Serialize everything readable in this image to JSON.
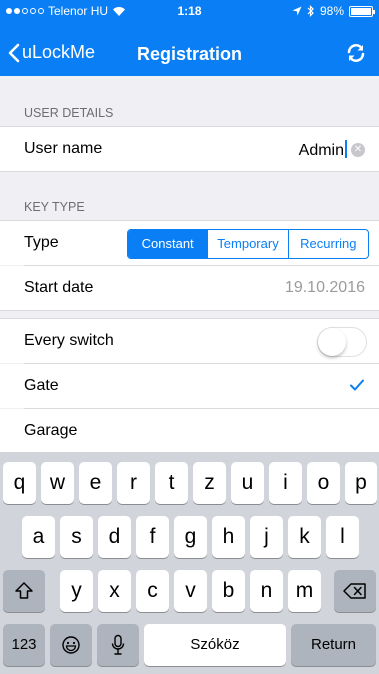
{
  "status_bar": {
    "carrier": "Telenor HU",
    "time": "1:18",
    "battery": "98%"
  },
  "nav": {
    "back_label": "uLockMe",
    "title": "Registration",
    "refresh_icon": "refresh-icon"
  },
  "sections": {
    "user_details_header": "USER DETAILS",
    "key_type_header": "KEY TYPE"
  },
  "user_name": {
    "label": "User name",
    "value": "Admin"
  },
  "key_type": {
    "label": "Type",
    "options": [
      "Constant",
      "Temporary",
      "Recurring"
    ],
    "selected": "Constant"
  },
  "start_date": {
    "label": "Start date",
    "value": "19.10.2016"
  },
  "switches": {
    "every_switch_label": "Every switch",
    "every_switch_on": false,
    "gate_label": "Gate",
    "gate_checked": true,
    "garage_label": "Garage"
  },
  "colors": {
    "accent": "#0a7ff5"
  },
  "keyboard": {
    "row1": [
      "q",
      "w",
      "e",
      "r",
      "t",
      "z",
      "u",
      "i",
      "o",
      "p"
    ],
    "row2": [
      "a",
      "s",
      "d",
      "f",
      "g",
      "h",
      "j",
      "k",
      "l"
    ],
    "row3": [
      "y",
      "x",
      "c",
      "v",
      "b",
      "n",
      "m"
    ],
    "numbers_key": "123",
    "space_key": "Szóköz",
    "return_key": "Return"
  }
}
